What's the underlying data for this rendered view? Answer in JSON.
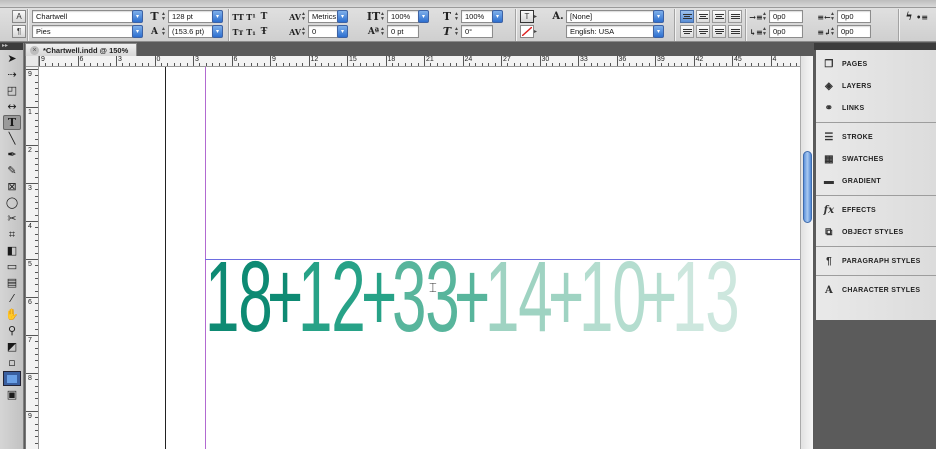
{
  "control_bar": {
    "font_family": "Chartwell",
    "font_style": "Pies",
    "font_size": "128 pt",
    "leading": "(153.6 pt)",
    "kerning": "Metrics",
    "tracking": "0",
    "vertical_scale": "100%",
    "horizontal_scale": "100%",
    "baseline_shift": "0 pt",
    "skew": "0°",
    "character_style": "[None]",
    "language": "English: USA",
    "indent_left": "0p0",
    "indent_first": "0p0",
    "indent_right": "0p0",
    "indent_last": "0p0",
    "space_before": "0p0",
    "space_after": "0p0"
  },
  "document": {
    "tab_title": "*Chartwell.indd @ 150%",
    "ruler_labels": [
      "9",
      "6",
      "3",
      "0",
      "3",
      "6",
      "9",
      "12",
      "15",
      "18",
      "21",
      "24",
      "27",
      "30",
      "33",
      "36",
      "39",
      "42",
      "45",
      "4"
    ],
    "vruler_labels": [
      "9",
      "1",
      "2",
      "3",
      "4",
      "5",
      "6",
      "7",
      "8",
      "9"
    ],
    "chart_text": [
      {
        "text": "18",
        "color": "#0e8a73"
      },
      {
        "text": "+",
        "color": "#0e8a73"
      },
      {
        "text": "12",
        "color": "#27a287"
      },
      {
        "text": "+",
        "color": "#27a287"
      },
      {
        "text": "33",
        "color": "#58b59c"
      },
      {
        "text": "+",
        "color": "#58b59c"
      },
      {
        "text": "14",
        "color": "#9fd3c2"
      },
      {
        "text": "+",
        "color": "#9fd3c2"
      },
      {
        "text": "10",
        "color": "#b4ddcf"
      },
      {
        "text": "+",
        "color": "#b4ddcf"
      },
      {
        "text": "13",
        "color": "#cde7de"
      }
    ]
  },
  "panels": {
    "group1": [
      {
        "label": "PAGES",
        "icon": "pages-icon"
      },
      {
        "label": "LAYERS",
        "icon": "layers-icon"
      },
      {
        "label": "LINKS",
        "icon": "links-icon"
      }
    ],
    "group2": [
      {
        "label": "STROKE",
        "icon": "stroke-icon"
      },
      {
        "label": "SWATCHES",
        "icon": "swatches-icon"
      },
      {
        "label": "GRADIENT",
        "icon": "gradient-icon"
      }
    ],
    "group3": [
      {
        "label": "EFFECTS",
        "icon": "effects-icon"
      },
      {
        "label": "OBJECT STYLES",
        "icon": "object-styles-icon"
      }
    ],
    "group4": [
      {
        "label": "PARAGRAPH STYLES",
        "icon": "paragraph-styles-icon"
      }
    ],
    "group5": [
      {
        "label": "CHARACTER STYLES",
        "icon": "character-styles-icon"
      }
    ]
  }
}
